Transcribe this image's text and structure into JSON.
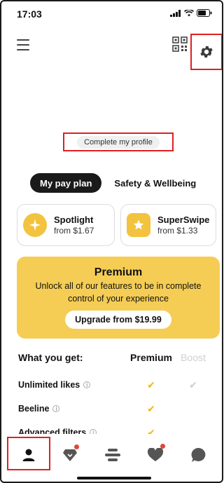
{
  "status_bar": {
    "time": "17:03"
  },
  "profile": {
    "complete_label": "Complete my profile"
  },
  "tabs": [
    {
      "label": "My pay plan",
      "active": true
    },
    {
      "label": "Safety & Wellbeing",
      "active": false
    }
  ],
  "cards": [
    {
      "title": "Spotlight",
      "price": "from $1.67",
      "icon": "spotlight-icon"
    },
    {
      "title": "SuperSwipe",
      "price": "from $1.33",
      "icon": "superswipe-icon"
    }
  ],
  "premium": {
    "title": "Premium",
    "description": "Unlock all of our features to be in complete control of your experience",
    "button_label": "Upgrade from $19.99"
  },
  "features": {
    "header": {
      "what": "What you get:",
      "premium": "Premium",
      "boost": "Boost"
    },
    "rows": [
      {
        "name": "Unlimited likes",
        "premium": "✔",
        "boost": "✔"
      },
      {
        "name": "Beeline",
        "premium": "✔",
        "boost": ""
      },
      {
        "name": "Advanced filters",
        "premium": "✔",
        "boost": ""
      }
    ]
  },
  "colors": {
    "accent": "#f5cd55",
    "highlight": "#e02020",
    "dark": "#1a1a1a"
  }
}
